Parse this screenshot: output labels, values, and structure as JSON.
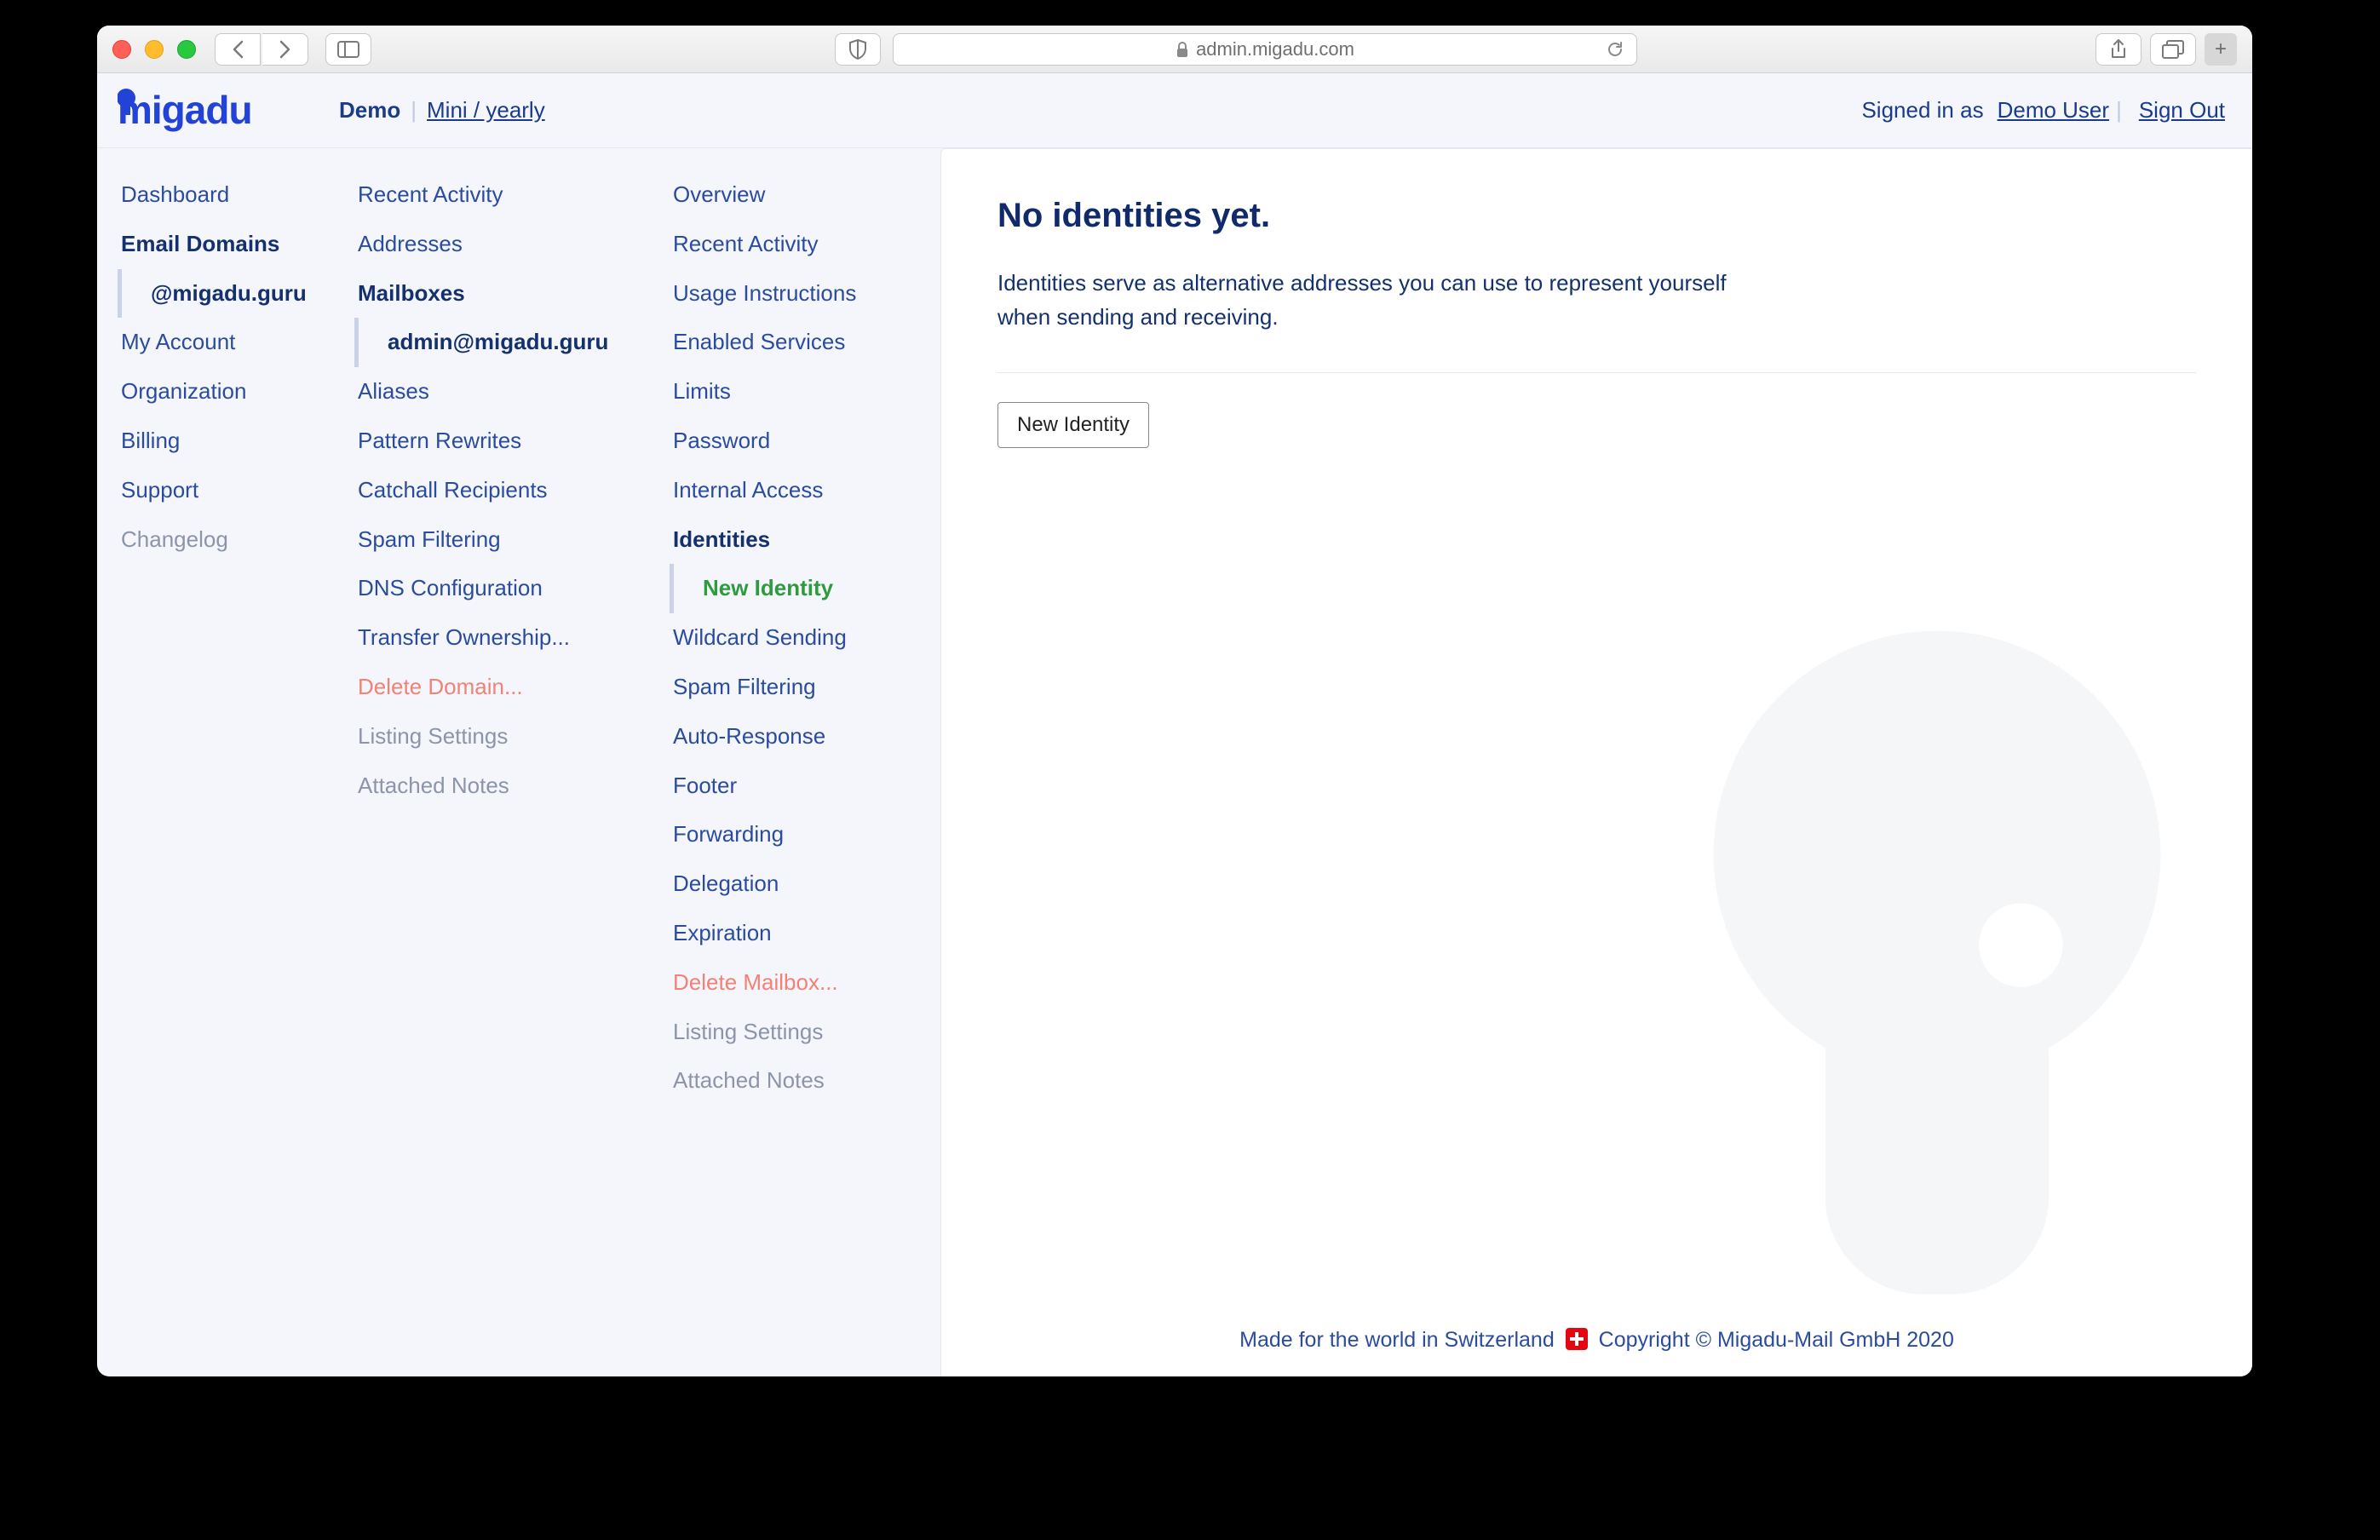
{
  "browser": {
    "url": "admin.migadu.com"
  },
  "header": {
    "logo": "migadu",
    "demo": "Demo",
    "plan": "Mini / yearly",
    "signed_in_as": "Signed in as",
    "user": "Demo User",
    "sign_out": "Sign Out"
  },
  "nav1": {
    "dashboard": "Dashboard",
    "email_domains": "Email Domains",
    "domain_sub": "@migadu.guru",
    "my_account": "My Account",
    "organization": "Organization",
    "billing": "Billing",
    "support": "Support",
    "changelog": "Changelog"
  },
  "nav2": {
    "recent_activity": "Recent Activity",
    "addresses": "Addresses",
    "mailboxes": "Mailboxes",
    "mailbox_sub": "admin@migadu.guru",
    "aliases": "Aliases",
    "pattern_rewrites": "Pattern Rewrites",
    "catchall": "Catchall Recipients",
    "spam_filtering": "Spam Filtering",
    "dns": "DNS Configuration",
    "transfer": "Transfer Ownership...",
    "delete_domain": "Delete Domain...",
    "listing_settings": "Listing Settings",
    "attached_notes": "Attached Notes"
  },
  "nav3": {
    "overview": "Overview",
    "recent_activity": "Recent Activity",
    "usage": "Usage Instructions",
    "enabled": "Enabled Services",
    "limits": "Limits",
    "password": "Password",
    "internal_access": "Internal Access",
    "identities": "Identities",
    "new_identity": "New Identity",
    "wildcard": "Wildcard Sending",
    "spam_filtering": "Spam Filtering",
    "auto_response": "Auto-Response",
    "footer": "Footer",
    "forwarding": "Forwarding",
    "delegation": "Delegation",
    "expiration": "Expiration",
    "delete_mailbox": "Delete Mailbox...",
    "listing_settings": "Listing Settings",
    "attached_notes": "Attached Notes"
  },
  "main": {
    "title": "No identities yet.",
    "desc": "Identities serve as alternative addresses you can use to represent yourself when sending and receiving.",
    "button": "New Identity"
  },
  "footer": {
    "left": "Made for the world in Switzerland",
    "right": "Copyright © Migadu-Mail GmbH 2020"
  }
}
